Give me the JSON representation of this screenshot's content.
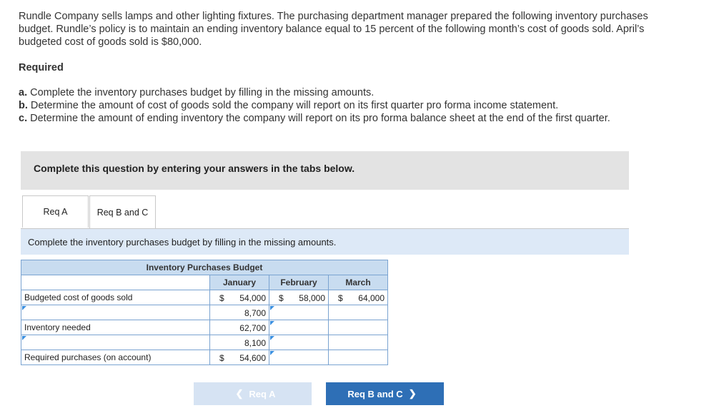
{
  "problem": {
    "intro": "Rundle Company sells lamps and other lighting fixtures. The purchasing department manager prepared the following inventory purchases budget. Rundle’s policy is to maintain an ending inventory balance equal to 15 percent of the following month’s cost of goods sold. April’s budgeted cost of goods sold is $80,000.",
    "required_heading": "Required",
    "items": [
      {
        "letter": "a.",
        "text": "Complete the inventory purchases budget by filling in the missing amounts."
      },
      {
        "letter": "b.",
        "text": "Determine the amount of cost of goods sold the company will report on its first quarter pro forma income statement."
      },
      {
        "letter": "c.",
        "text": "Determine the amount of ending inventory the company will report on its pro forma balance sheet at the end of the first quarter."
      }
    ]
  },
  "banner": "Complete this question by entering your answers in the tabs below.",
  "tabs": [
    {
      "label": "Req A",
      "active": true
    },
    {
      "label": "Req B and C",
      "active": false
    }
  ],
  "instruction": "Complete the inventory purchases budget by filling in the missing amounts.",
  "budget": {
    "title": "Inventory Purchases Budget",
    "months": [
      "January",
      "February",
      "March"
    ],
    "rows": [
      {
        "label": "Budgeted cost of goods sold",
        "jan": "54,000",
        "jan_dollar": "$",
        "feb": "58,000",
        "feb_dollar": "$",
        "mar": "64,000",
        "mar_dollar": "$"
      },
      {
        "label": "",
        "jan": "8,700",
        "feb": "",
        "mar": ""
      },
      {
        "label": "Inventory needed",
        "jan": "62,700",
        "feb": "",
        "mar": ""
      },
      {
        "label": "",
        "jan": "8,100",
        "feb": "",
        "mar": ""
      },
      {
        "label": "Required purchases (on account)",
        "jan": "54,600",
        "jan_dollar": "$",
        "feb": "",
        "mar": ""
      }
    ]
  },
  "nav": {
    "prev_label": "Req A",
    "next_label": "Req B and C",
    "prev_icon": "chevron-left-icon",
    "next_icon": "chevron-right-icon"
  },
  "colors": {
    "banner_bg": "#e3e3e3",
    "instruction_bg": "#dde9f7",
    "table_header_bg": "#c8dcf0",
    "next_button": "#2e6fb6",
    "prev_button_disabled": "#d6e3f3"
  }
}
